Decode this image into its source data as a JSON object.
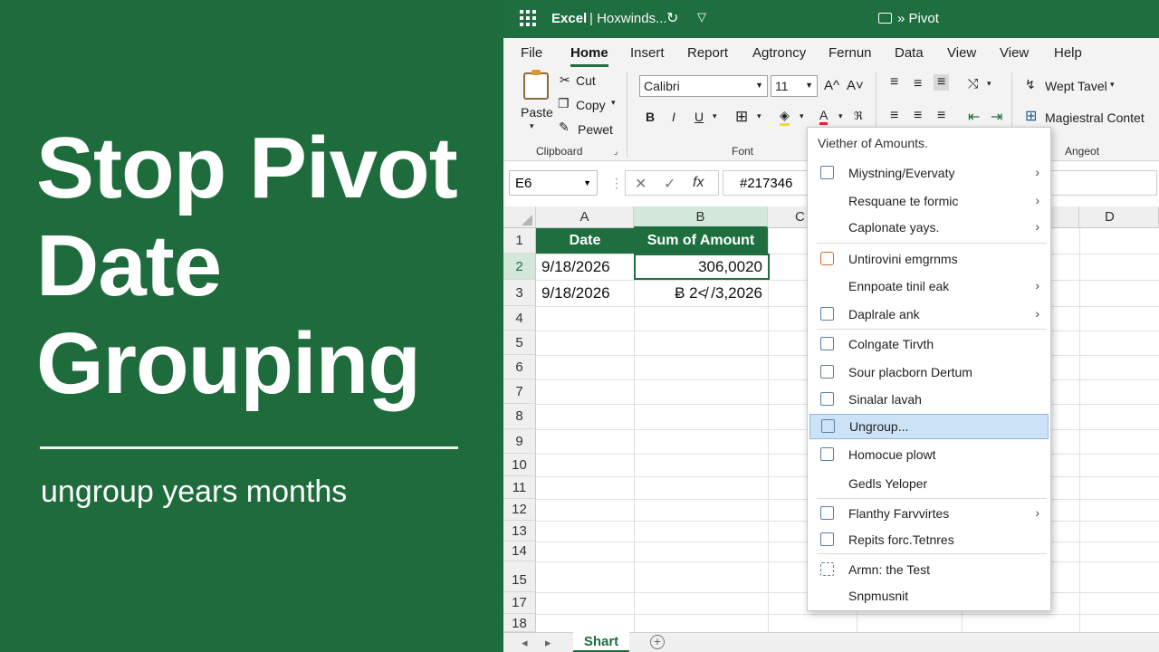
{
  "promo": {
    "title_lines": [
      "Stop Pivot",
      "Date",
      "Grouping"
    ],
    "subtitle": "ungroup years months"
  },
  "window": {
    "app_name": "Excel",
    "doc_name": "| Hoxwinds...",
    "right_title": "» Pivot",
    "accent": "#1f6e40"
  },
  "tabs": [
    "File",
    "Home",
    "Insert",
    "Report",
    "Agtroncy",
    "Fernun",
    "Data",
    "View",
    "View",
    "Help"
  ],
  "active_tab": "Home",
  "ribbon": {
    "clipboard": {
      "paste": "Paste",
      "cut": "Cut",
      "copy": "Copy",
      "painter": "Pewet",
      "group_label": "Clipboard"
    },
    "font": {
      "name": "Calibri",
      "size": "11",
      "grow": "A^",
      "shrink": "A˅",
      "bold": "B",
      "italic": "I",
      "underline": "U",
      "group_label": "Font"
    },
    "align": {
      "group_label": "Angeot"
    },
    "wrap": "Wept Tavel",
    "merge": "Magiestral Contet"
  },
  "formula_bar": {
    "name_box": "E6",
    "fx": "fx",
    "value": "#217346"
  },
  "columns": [
    "A",
    "B",
    "C",
    "D"
  ],
  "rows": [
    "1",
    "2",
    "3",
    "4",
    "5",
    "6",
    "7",
    "8",
    "9",
    "10",
    "11",
    "12",
    "13",
    "14",
    "15",
    "17",
    "18"
  ],
  "cells": {
    "a1": "Date",
    "b1": "Sum of Amount",
    "a2": "9/18/2026",
    "b2": "306,0020",
    "a3": "9/18/2026",
    "b3": "Ƀ 2≮ /3,2026"
  },
  "sheet_tab": "Shart",
  "context_menu": {
    "header": "Viether of Amounts.",
    "items": [
      {
        "label": "Miystning/Evervaty",
        "submenu": true,
        "icon": "document-icon"
      },
      {
        "label": "Resquane te formic",
        "submenu": true,
        "icon": ""
      },
      {
        "label": "Caplonate yays.",
        "submenu": true,
        "icon": ""
      },
      {
        "label": "Untirovini emgrnms",
        "submenu": false,
        "icon": "copy-icon"
      },
      {
        "label": "Ennpoate tinil eak",
        "submenu": true,
        "icon": ""
      },
      {
        "label": "Daplrale ank",
        "submenu": true,
        "icon": "edit-icon"
      },
      {
        "label": "Colngate Tirvth",
        "submenu": false,
        "icon": "clipboard-icon"
      },
      {
        "label": "Sour placborn Dertum",
        "submenu": false,
        "icon": "table-icon"
      },
      {
        "label": "Sinalar lavah",
        "submenu": false,
        "icon": "chart-icon"
      },
      {
        "label": "Ungroup...",
        "submenu": false,
        "icon": "ungroup-icon",
        "highlighted": true
      },
      {
        "label": "Homocue plowt",
        "submenu": false,
        "icon": "grid-icon"
      },
      {
        "label": "Gedls Yeloper",
        "submenu": false,
        "icon": ""
      },
      {
        "label": "Flanthy Farvvirtes",
        "submenu": true,
        "icon": "favorites-icon"
      },
      {
        "label": "Repits forc.Tetnres",
        "submenu": false,
        "icon": "field-icon"
      },
      {
        "label": "Armn: the Test",
        "submenu": false,
        "icon": "settings-icon"
      },
      {
        "label": "Snpmusnit",
        "submenu": false,
        "icon": ""
      }
    ]
  }
}
